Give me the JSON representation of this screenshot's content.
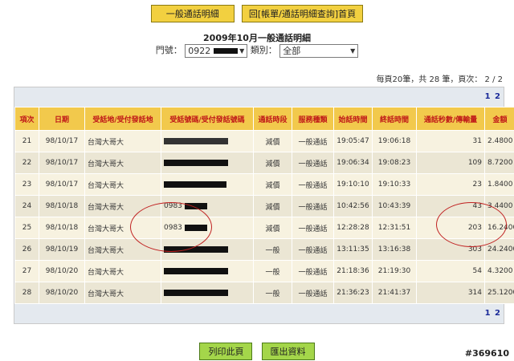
{
  "top_buttons": {
    "general_details": "一般通話明細",
    "back_home": "回[帳單/通話明細查詢]首頁"
  },
  "page_title": "2009年10月一般通話明細",
  "filters": {
    "number_label": "門號：",
    "number_value": "0922",
    "category_label": "類別：",
    "category_value": "全部"
  },
  "page_info": "每頁20筆，共 28 筆，頁次： 2 / 2",
  "pagination": {
    "page1": "1",
    "page2": "2"
  },
  "table": {
    "headers": [
      "項次",
      "日期",
      "受話地/受付發話地",
      "受話號碼/受付發話號碼",
      "通話時段",
      "服務種類",
      "始話時間",
      "終話時間",
      "通話秒數/傳輸量",
      "金額"
    ],
    "rows": [
      {
        "no": "21",
        "date": "98/10/17",
        "place": "台灣大哥大",
        "number": "",
        "period": "減價",
        "service": "一般通話",
        "start": "19:05:47",
        "end": "19:06:18",
        "seconds": "31",
        "amount": "2.4800"
      },
      {
        "no": "22",
        "date": "98/10/17",
        "place": "台灣大哥大",
        "number": "",
        "period": "減價",
        "service": "一般通話",
        "start": "19:06:34",
        "end": "19:08:23",
        "seconds": "109",
        "amount": "8.7200"
      },
      {
        "no": "23",
        "date": "98/10/17",
        "place": "台灣大哥大",
        "number": "",
        "period": "減價",
        "service": "一般通話",
        "start": "19:10:10",
        "end": "19:10:33",
        "seconds": "23",
        "amount": "1.8400"
      },
      {
        "no": "24",
        "date": "98/10/18",
        "place": "台灣大哥大",
        "number": "0983",
        "period": "減價",
        "service": "一般通話",
        "start": "10:42:56",
        "end": "10:43:39",
        "seconds": "43",
        "amount": "3.4400"
      },
      {
        "no": "25",
        "date": "98/10/18",
        "place": "台灣大哥大",
        "number": "0983",
        "period": "減價",
        "service": "一般通話",
        "start": "12:28:28",
        "end": "12:31:51",
        "seconds": "203",
        "amount": "16.2400"
      },
      {
        "no": "26",
        "date": "98/10/19",
        "place": "台灣大哥大",
        "number": "",
        "period": "一般",
        "service": "一般通話",
        "start": "13:11:35",
        "end": "13:16:38",
        "seconds": "303",
        "amount": "24.2400"
      },
      {
        "no": "27",
        "date": "98/10/20",
        "place": "台灣大哥大",
        "number": "",
        "period": "一般",
        "service": "一般通話",
        "start": "21:18:36",
        "end": "21:19:30",
        "seconds": "54",
        "amount": "4.3200"
      },
      {
        "no": "28",
        "date": "98/10/20",
        "place": "台灣大哥大",
        "number": "",
        "period": "一般",
        "service": "一般通話",
        "start": "21:36:23",
        "end": "21:41:37",
        "seconds": "314",
        "amount": "25.1200"
      }
    ]
  },
  "bottom_buttons": {
    "print": "列印此頁",
    "export": "匯出資料"
  },
  "watermark": "#369610",
  "colors": {
    "header_bg": "#f2c94c",
    "header_text": "#c01818",
    "button_yellow": "#f2d040",
    "button_green": "#a4d64a",
    "annotation_red": "#c02020"
  }
}
